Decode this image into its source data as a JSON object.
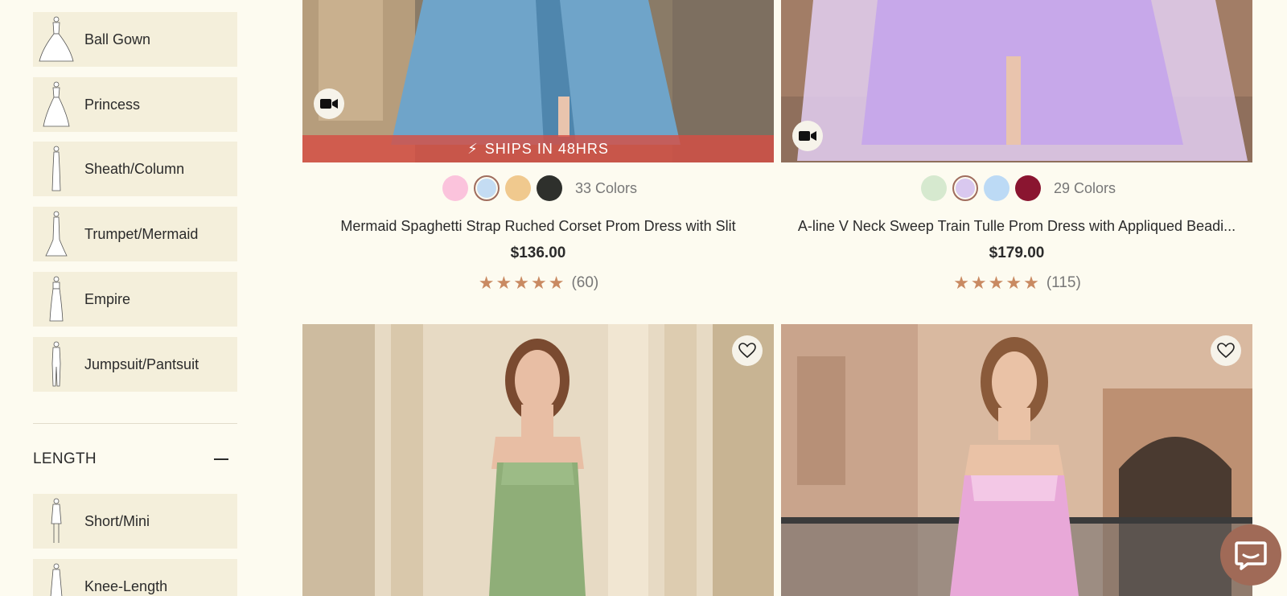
{
  "silhouettes": [
    {
      "label": "Ball Gown",
      "icon": "ball-gown-icon"
    },
    {
      "label": "Princess",
      "icon": "princess-icon"
    },
    {
      "label": "Sheath/Column",
      "icon": "sheath-column-icon"
    },
    {
      "label": "Trumpet/Mermaid",
      "icon": "trumpet-mermaid-icon"
    },
    {
      "label": "Empire",
      "icon": "empire-icon"
    },
    {
      "label": "Jumpsuit/Pantsuit",
      "icon": "jumpsuit-icon"
    }
  ],
  "length_section": {
    "title": "LENGTH",
    "items": [
      {
        "label": "Short/Mini",
        "icon": "short-mini-icon"
      },
      {
        "label": "Knee-Length",
        "icon": "knee-length-icon"
      }
    ]
  },
  "products": [
    {
      "name": "Mermaid Spaghetti Strap Ruched Corset Prom Dress with Slit",
      "price": "$136.00",
      "colors_label": "33 Colors",
      "swatches": [
        "#fbc3dc",
        "#c4dcf3",
        "#f0c98e",
        "#2e302c"
      ],
      "selected_swatch": 1,
      "reviews": "(60)",
      "rating": 5,
      "badge": "SHIPS IN 48HRS",
      "dress_color": "#6fa4c9"
    },
    {
      "name": "A-line V Neck Sweep Train Tulle Prom Dress with Appliqued Beadi...",
      "price": "$179.00",
      "colors_label": "29 Colors",
      "swatches": [
        "#d6e9cf",
        "#d9c8ef",
        "#bcdaf5",
        "#8a1530"
      ],
      "selected_swatch": 1,
      "reviews": "(115)",
      "rating": 5,
      "dress_color": "#c7a8ea"
    },
    {
      "dress_color": "#8fae78"
    },
    {
      "dress_color": "#e8a8d8"
    }
  ],
  "colors": {
    "accent": "#a06a57",
    "star": "#c98a62",
    "banner": "#d64e44",
    "sidebar_item_bg": "#f4efdb",
    "page_bg": "#fdfbf0"
  }
}
